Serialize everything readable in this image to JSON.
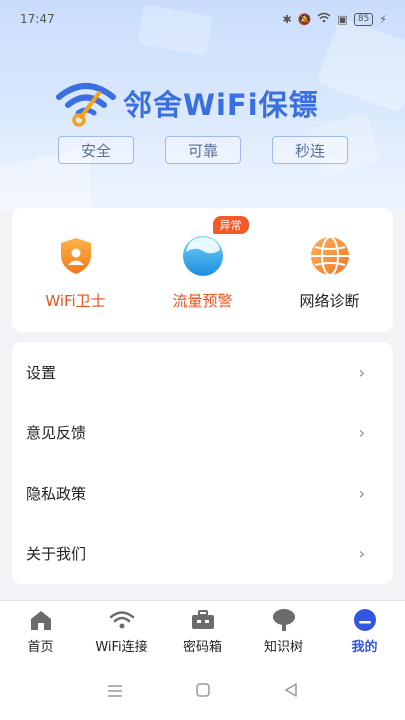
{
  "status_bar": {
    "time": "17:47",
    "battery": "85"
  },
  "header": {
    "title": "邻舍WiFi保镖",
    "tags": [
      "安全",
      "可靠",
      "秒连"
    ]
  },
  "features": [
    {
      "label": "WiFi卫士",
      "icon": "shield-user-icon",
      "color": "#e8541e"
    },
    {
      "label": "流量预警",
      "icon": "water-ball-icon",
      "badge": "异常",
      "color": "#e8541e"
    },
    {
      "label": "网络诊断",
      "icon": "globe-icon",
      "color": "#222222"
    }
  ],
  "menu": [
    {
      "label": "设置"
    },
    {
      "label": "意见反馈"
    },
    {
      "label": "隐私政策"
    },
    {
      "label": "关于我们"
    }
  ],
  "tabs": [
    {
      "label": "首页",
      "icon": "home-icon"
    },
    {
      "label": "WiFi连接",
      "icon": "wifi-icon"
    },
    {
      "label": "密码箱",
      "icon": "toolbox-icon"
    },
    {
      "label": "知识树",
      "icon": "tree-icon"
    },
    {
      "label": "我的",
      "icon": "profile-icon",
      "active": true
    }
  ],
  "colors": {
    "accent": "#3356e0",
    "orange": "#e8541e",
    "banner": "#c9ddfb"
  }
}
